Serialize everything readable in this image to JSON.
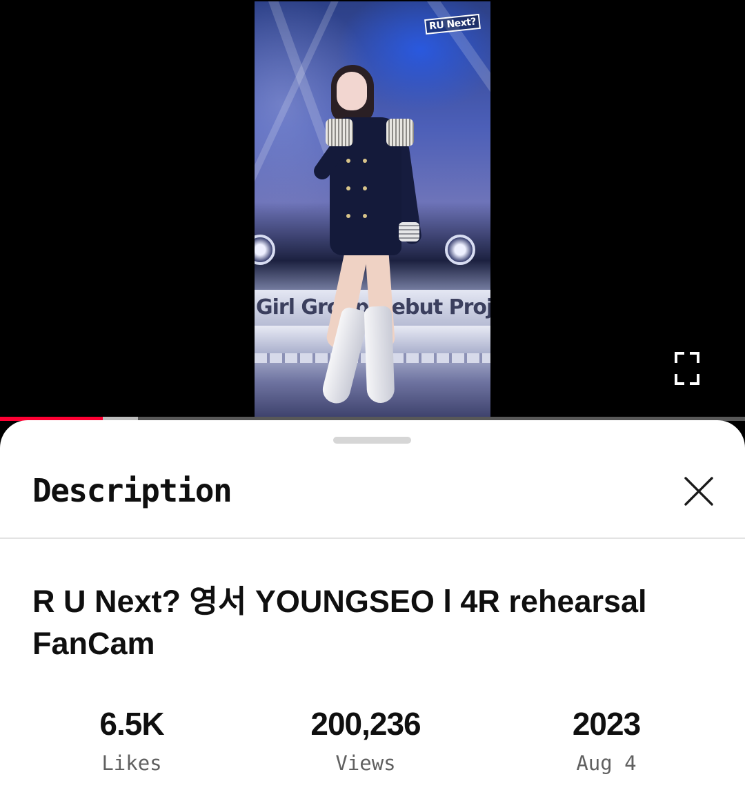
{
  "video": {
    "logo_text": "RU Next?",
    "stage_text": "Girl Group Debut Project",
    "progress": {
      "played_fraction": 0.138,
      "buffered_fraction": 0.185,
      "played_color": "#ff0033"
    },
    "controls": {
      "fullscreen_icon": "fullscreen-icon"
    }
  },
  "sheet": {
    "title": "Description",
    "close_icon": "close-icon",
    "video_title": "R U Next? 영서 YOUNGSEO l 4R rehearsal FanCam",
    "stats": {
      "likes": {
        "value": "6.5K",
        "label": "Likes"
      },
      "views": {
        "value": "200,236",
        "label": "Views"
      },
      "date": {
        "value": "2023",
        "label": "Aug 4"
      }
    }
  }
}
